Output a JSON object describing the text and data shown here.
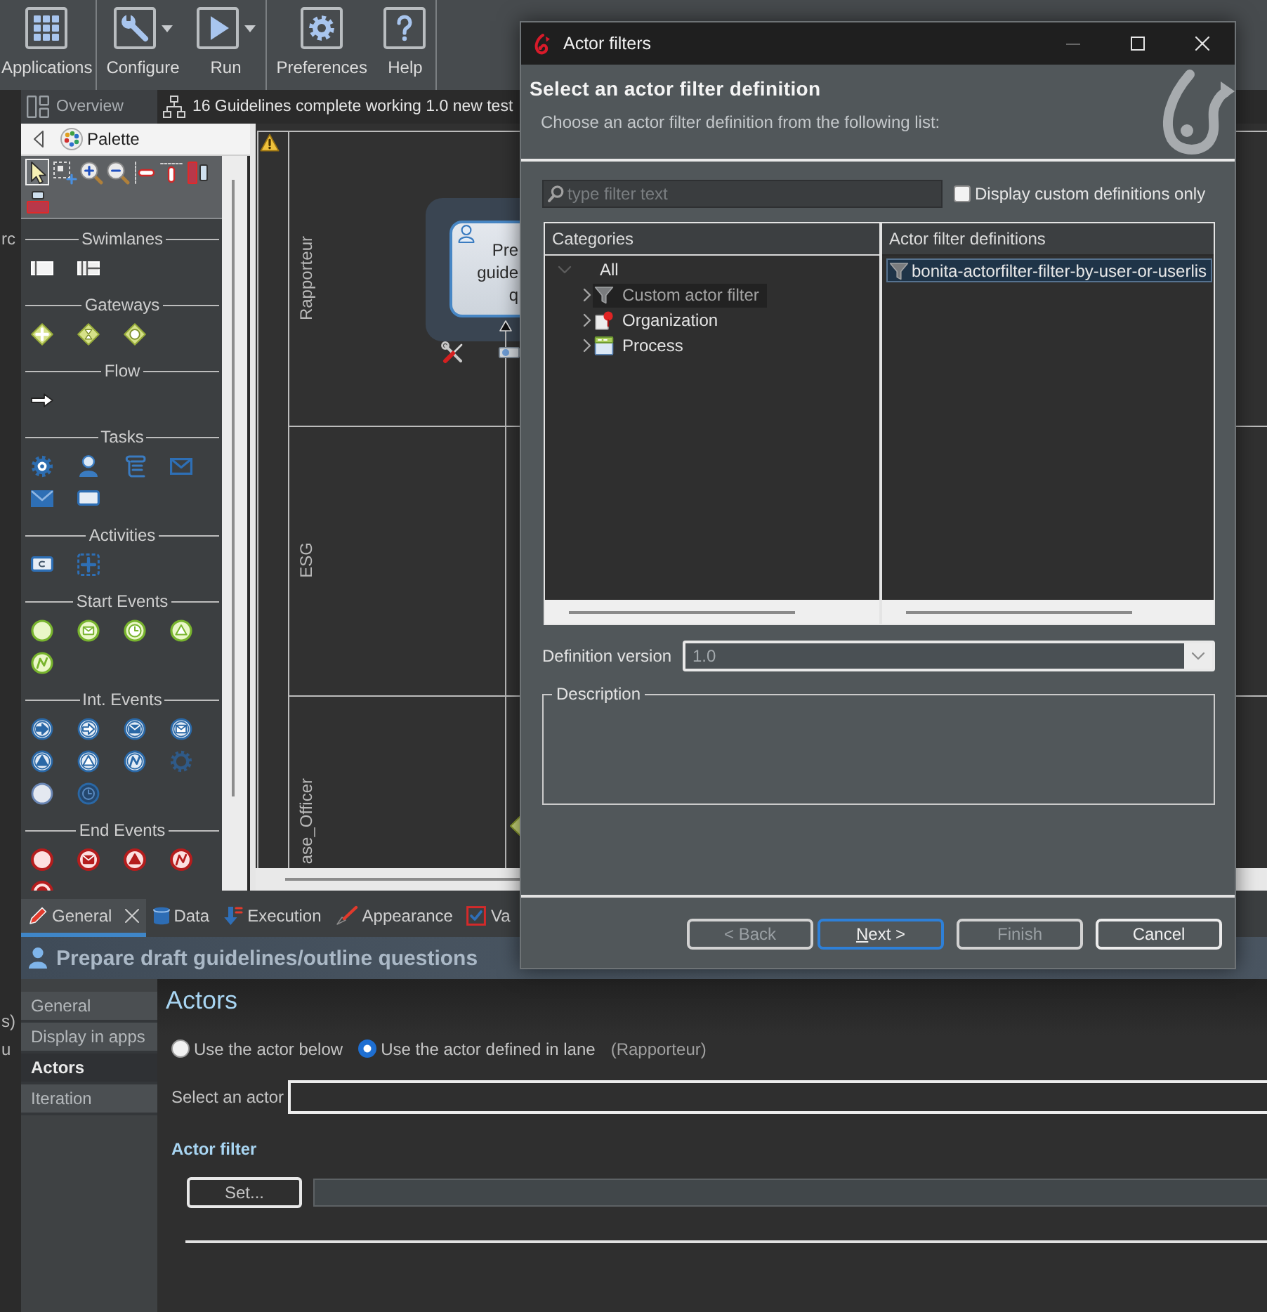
{
  "toolbar": {
    "groups": [
      {
        "items": [
          {
            "label": "Applications",
            "dropdown": false
          }
        ]
      },
      {
        "items": [
          {
            "label": "Configure",
            "dropdown": true
          },
          {
            "label": "Run",
            "dropdown": true
          }
        ]
      },
      {
        "items": [
          {
            "label": "Preferences",
            "dropdown": false
          },
          {
            "label": "Help",
            "dropdown": false
          }
        ]
      }
    ]
  },
  "left_edge_texts": [
    "rc",
    "s)",
    "u"
  ],
  "editor_tabs": [
    {
      "label": "Overview",
      "selected": false
    },
    {
      "label": "16 Guidelines complete working 1.0 new test",
      "selected": true
    }
  ],
  "palette": {
    "title": "Palette",
    "tools": [
      {
        "selected": true
      },
      {
        "selected": false
      },
      {
        "selected": false
      },
      {
        "selected": false
      },
      {
        "selected": false
      },
      {
        "selected": false
      },
      {
        "selected": false
      },
      {
        "selected": false
      }
    ],
    "sections": [
      {
        "title": "Swimlanes"
      },
      {
        "title": "Gateways"
      },
      {
        "title": "Flow"
      },
      {
        "title": "Tasks"
      },
      {
        "title": "Activities"
      },
      {
        "title": "Start Events"
      },
      {
        "title": "Int. Events"
      },
      {
        "title": "End Events"
      }
    ]
  },
  "diagram": {
    "lanes": [
      {
        "name": "Rapporteur"
      },
      {
        "name": "ESG"
      },
      {
        "name": "ase_Officer"
      }
    ],
    "task": {
      "label_lines": [
        "Pre",
        "guide",
        "q"
      ],
      "selected": true
    }
  },
  "properties": {
    "tabs": [
      {
        "label": "General",
        "selected": true
      },
      {
        "label": "Data",
        "selected": false
      },
      {
        "label": "Execution",
        "selected": false
      },
      {
        "label": "Appearance",
        "selected": false
      },
      {
        "label": "Va",
        "selected": false
      }
    ],
    "title": "Prepare draft guidelines/outline questions",
    "nav": [
      {
        "label": "General",
        "selected": false
      },
      {
        "label": "Display in apps",
        "selected": false
      },
      {
        "label": "Actors",
        "selected": true
      },
      {
        "label": "Iteration",
        "selected": false
      }
    ],
    "section_title": "Actors",
    "actor_choice": [
      {
        "label": "Use the actor below",
        "selected": false
      },
      {
        "label": "Use the actor defined in lane",
        "selected": true,
        "note": "(Rapporteur)"
      }
    ],
    "actor_select": {
      "label": "Select an actor"
    },
    "actor_filter": {
      "title": "Actor filter",
      "button": "Set..."
    }
  },
  "dialog": {
    "title": "Actor filters",
    "heading": "Select an actor filter definition",
    "subtitle": "Choose an actor filter definition from the following list:",
    "filter": {
      "placeholder": "type filter text"
    },
    "custom_only": {
      "label": "Display custom definitions only",
      "checked": false
    },
    "categories": {
      "header": "Categories",
      "tree": [
        {
          "label": "All",
          "expanded": true,
          "selected": false,
          "children": [
            {
              "label": "Custom actor filter",
              "expanded": false,
              "selected": true
            },
            {
              "label": "Organization",
              "expanded": false,
              "selected": false
            },
            {
              "label": "Process",
              "expanded": false,
              "selected": false
            }
          ]
        }
      ]
    },
    "definitions": {
      "header": "Actor filter definitions",
      "items": [
        {
          "label": "bonita-actorfilter-filter-by-user-or-userlis",
          "selected": true
        }
      ]
    },
    "version": {
      "label": "Definition version",
      "value": "1.0",
      "disabled": true
    },
    "description": {
      "title": "Description"
    },
    "buttons": [
      {
        "label": "< Back",
        "disabled": true,
        "default": false
      },
      {
        "label": "Next >",
        "disabled": false,
        "default": true
      },
      {
        "label": "Finish",
        "disabled": true,
        "default": false
      },
      {
        "label": "Cancel",
        "disabled": false,
        "default": false
      }
    ]
  }
}
